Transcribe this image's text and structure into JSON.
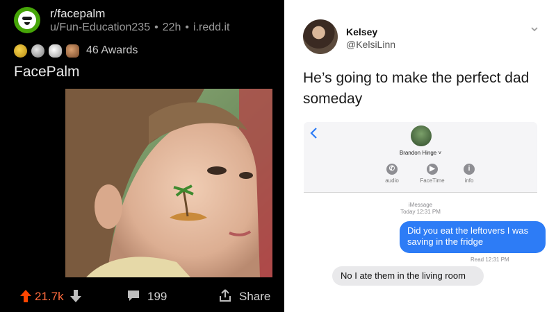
{
  "reddit": {
    "subreddit": "r/facepalm",
    "author": "u/Fun-Education235",
    "age": "22h",
    "domain": "i.redd.it",
    "awards_text": "46 Awards",
    "title": "FacePalm",
    "score": "21.7k",
    "comments": "199",
    "share_label": "Share",
    "icons": [
      "subreddit-icon",
      "award-icon",
      "upvote-icon",
      "downvote-icon",
      "comment-icon",
      "share-icon"
    ],
    "colors": {
      "upvote": "#ff4500",
      "score": "#ff6b3d",
      "subreddit_icon": "#46a508"
    }
  },
  "tweet": {
    "name": "Kelsey",
    "handle": "@KelsiLinn",
    "text": "He’s going to make the perfect dad someday",
    "imessage": {
      "contact": "Brandon Hinge",
      "actions": [
        {
          "label": "audio",
          "icon": "phone-icon"
        },
        {
          "label": "FaceTime",
          "icon": "video-icon"
        },
        {
          "label": "info",
          "icon": "info-icon"
        }
      ],
      "service": "iMessage",
      "timestamp": "Today 12:31 PM",
      "sent_message": "Did you eat the leftovers I was saving in the fridge",
      "read_receipt": "Read 12:31 PM",
      "received_message": "No I ate them in the living room",
      "colors": {
        "sent_bubble": "#2d7cf6",
        "received_bubble": "#e9e9eb"
      }
    }
  }
}
